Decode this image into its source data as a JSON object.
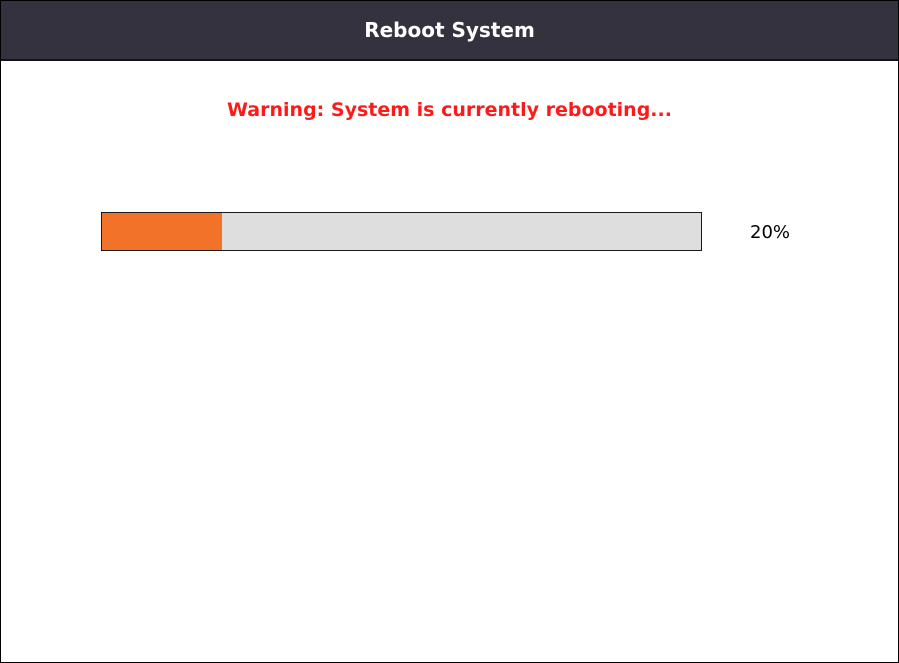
{
  "dialog": {
    "title": "Reboot System",
    "warning": "Warning: System is currently rebooting...",
    "progress": {
      "value": 0.2,
      "label": "20%"
    }
  },
  "colors": {
    "titlebar": "#34323f",
    "warning_text": "#ff1a1a",
    "progress_fill": "#f2722a",
    "progress_track": "#dedede"
  }
}
